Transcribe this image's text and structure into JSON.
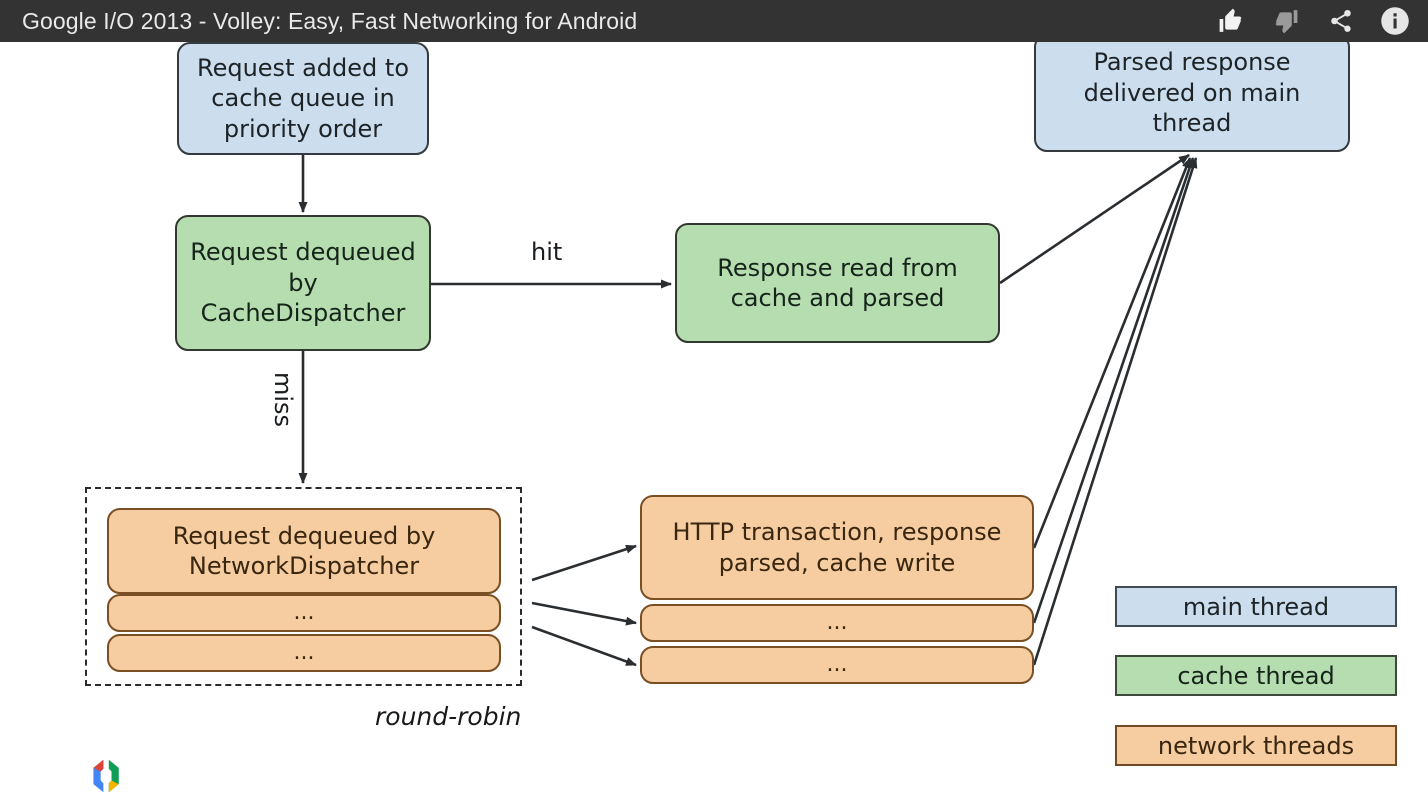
{
  "header": {
    "title": "Google I/O 2013 - Volley: Easy, Fast Networking for Android",
    "icons": [
      {
        "name": "thumbs-up-icon",
        "glyph": "↑"
      },
      {
        "name": "thumbs-down-icon",
        "glyph": "↓"
      },
      {
        "name": "share-icon",
        "glyph": "⤳"
      },
      {
        "name": "info-icon",
        "glyph": "i"
      }
    ],
    "background_color": "#333333",
    "text_color": "#e9e9e9"
  },
  "diagram": {
    "nodes": {
      "cache_queue": {
        "label": "Request added to cache queue in priority order",
        "thread": "main"
      },
      "cache_disp": {
        "label": "Request dequeued by CacheDispatcher",
        "thread": "cache"
      },
      "cache_read": {
        "label": "Response read from cache and parsed",
        "thread": "cache"
      },
      "parsed_resp": {
        "label": "Parsed response delivered on main thread",
        "thread": "main"
      },
      "net_disp": {
        "label": "Request dequeued by NetworkDispatcher",
        "thread": "network"
      },
      "net_dots_1": {
        "label": "...",
        "thread": "network"
      },
      "net_dots_2": {
        "label": "...",
        "thread": "network"
      },
      "http": {
        "label": "HTTP transaction, response parsed, cache write",
        "thread": "network"
      },
      "http_dots_1": {
        "label": "...",
        "thread": "network"
      },
      "http_dots_2": {
        "label": "...",
        "thread": "network"
      }
    },
    "edge_labels": {
      "hit": "hit",
      "miss": "miss"
    },
    "group_label": "round-robin"
  },
  "legend": {
    "items": [
      {
        "label": "main thread",
        "color": "#ccdeee"
      },
      {
        "label": "cache thread",
        "color": "#b6ddb0"
      },
      {
        "label": "network threads",
        "color": "#f5cda1"
      }
    ]
  },
  "logo": {
    "name": "google-developers-logo"
  },
  "colors": {
    "main_thread": "#ccdeee",
    "cache_thread": "#b6ddb0",
    "network_thread": "#f5cda1",
    "stroke": "#2f3437",
    "canvas": "#ffffff"
  }
}
